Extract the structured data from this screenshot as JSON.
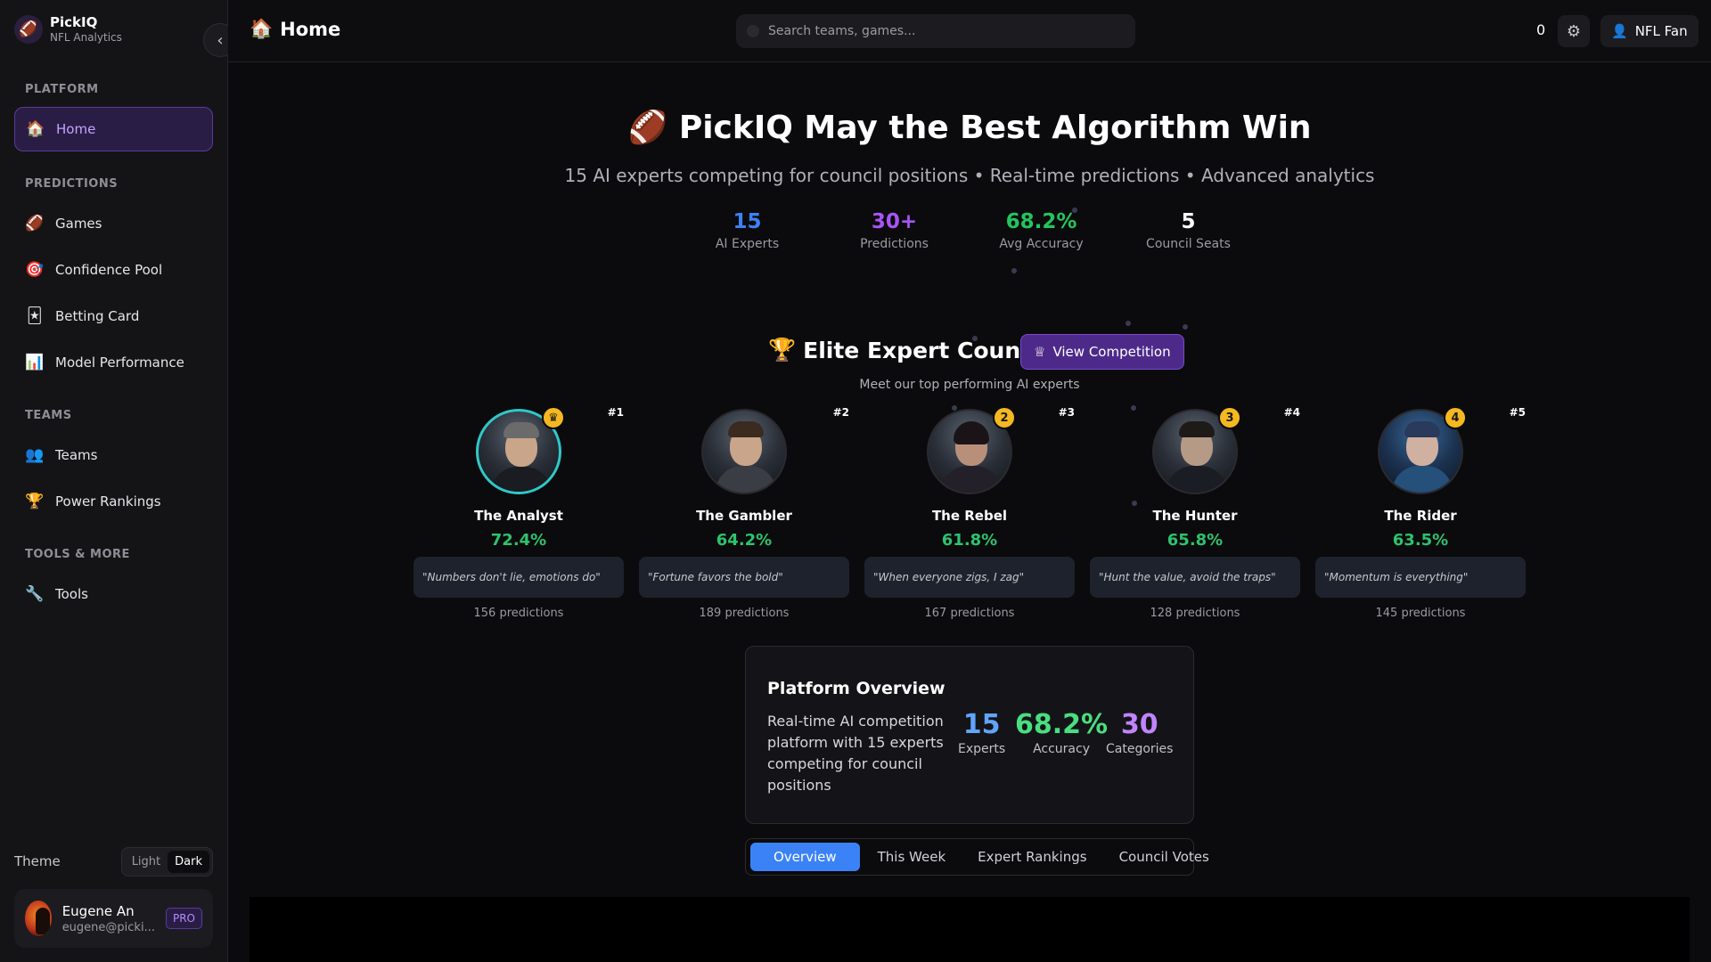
{
  "brand": {
    "name": "PickIQ",
    "subtitle": "NFL Analytics",
    "logo_icon": "football-icon"
  },
  "sidebar": {
    "sections": {
      "platform": "PLATFORM",
      "predictions": "PREDICTIONS",
      "teams": "TEAMS",
      "tools": "TOOLS & MORE"
    },
    "items": [
      {
        "label": "Home",
        "icon": "home-icon",
        "active": true
      },
      {
        "label": "Games",
        "icon": "football-icon"
      },
      {
        "label": "Confidence Pool",
        "icon": "target-icon"
      },
      {
        "label": "Betting Card",
        "icon": "card-icon"
      },
      {
        "label": "Model Performance",
        "icon": "chart-icon"
      },
      {
        "label": "Teams",
        "icon": "people-icon"
      },
      {
        "label": "Power Rankings",
        "icon": "trophy-icon"
      },
      {
        "label": "Tools",
        "icon": "wrench-icon"
      }
    ],
    "theme": {
      "label": "Theme",
      "light": "Light",
      "dark": "Dark",
      "selected": "Dark"
    },
    "user": {
      "name": "Eugene An",
      "email": "eugene@picki...",
      "badge": "PRO"
    }
  },
  "header": {
    "title": "Home",
    "search_placeholder": "Search teams, games...",
    "counter": "0",
    "user_label": "NFL Fan"
  },
  "hero": {
    "title": "PickIQ May the Best Algorithm Win",
    "subtitle": "15 AI experts competing for council positions • Real-time predictions • Advanced analytics",
    "stats": [
      {
        "value": "15",
        "label": "AI Experts",
        "color": "#3b82f6"
      },
      {
        "value": "30+",
        "label": "Predictions",
        "color": "#a855f7"
      },
      {
        "value": "68.2%",
        "label": "Avg Accuracy",
        "color": "#22c55e"
      },
      {
        "value": "5",
        "label": "Council Seats",
        "color": "#ffffff"
      }
    ]
  },
  "council": {
    "title": "Elite Expert Council",
    "button": "View Competition",
    "subtitle": "Meet our top performing AI experts",
    "experts": [
      {
        "rank": "#1",
        "badge": "crown",
        "name": "The Analyst",
        "accuracy": "72.4%",
        "quote": "\"Numbers don't lie, emotions do\"",
        "predictions": "156 predictions"
      },
      {
        "rank": "#2",
        "badge": "",
        "name": "The Gambler",
        "accuracy": "64.2%",
        "quote": "\"Fortune favors the bold\"",
        "predictions": "189 predictions"
      },
      {
        "rank": "#3",
        "badge": "2",
        "name": "The Rebel",
        "accuracy": "61.8%",
        "quote": "\"When everyone zigs, I zag\"",
        "predictions": "167 predictions"
      },
      {
        "rank": "#4",
        "badge": "3",
        "name": "The Hunter",
        "accuracy": "65.8%",
        "quote": "\"Hunt the value, avoid the traps\"",
        "predictions": "128 predictions"
      },
      {
        "rank": "#5",
        "badge": "4",
        "name": "The Rider",
        "accuracy": "63.5%",
        "quote": "\"Momentum is everything\"",
        "predictions": "145 predictions"
      }
    ]
  },
  "overview": {
    "title": "Platform Overview",
    "description": "Real-time AI competition platform with 15 experts competing for council positions",
    "stats": [
      {
        "value": "15",
        "label": "Experts",
        "color": "#60a5fa"
      },
      {
        "value": "68.2%",
        "label": "Accuracy",
        "color": "#4ade80"
      },
      {
        "value": "30",
        "label": "Categories",
        "color": "#c084fc"
      }
    ]
  },
  "tabs": [
    {
      "label": "Overview",
      "active": true
    },
    {
      "label": "This Week"
    },
    {
      "label": "Expert Rankings"
    },
    {
      "label": "Council Votes"
    }
  ]
}
